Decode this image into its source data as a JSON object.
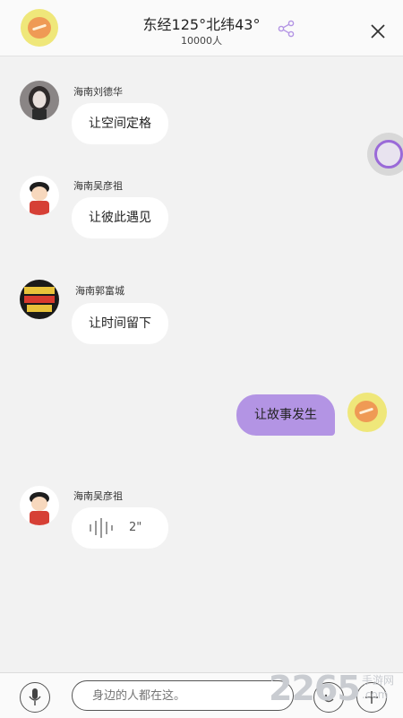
{
  "header": {
    "title": "东经125°北纬43°",
    "subtitle": "10000人"
  },
  "messages": [
    {
      "sender": "海南刘德华",
      "text": "让空间定格"
    },
    {
      "sender": "海南吴彦祖",
      "text": "让彼此遇见"
    },
    {
      "sender": "海南郭富城",
      "text": "让时间留下"
    },
    {
      "sender": "me",
      "text": "让故事发生"
    },
    {
      "sender": "海南吴彦祖",
      "voice_duration": "2\""
    }
  ],
  "composer": {
    "placeholder": "身边的人都在这。"
  },
  "watermark": {
    "number": "2265",
    "unit": ".com",
    "text": "手游网"
  },
  "colors": {
    "accent": "#b394e4",
    "float_ring": "#9a6ad8",
    "background": "#f2f2f2"
  },
  "icons": [
    "avatar-icon",
    "share-icon",
    "close-icon",
    "voice-wave-icon",
    "mic-icon",
    "emoji-icon",
    "plus-icon"
  ]
}
